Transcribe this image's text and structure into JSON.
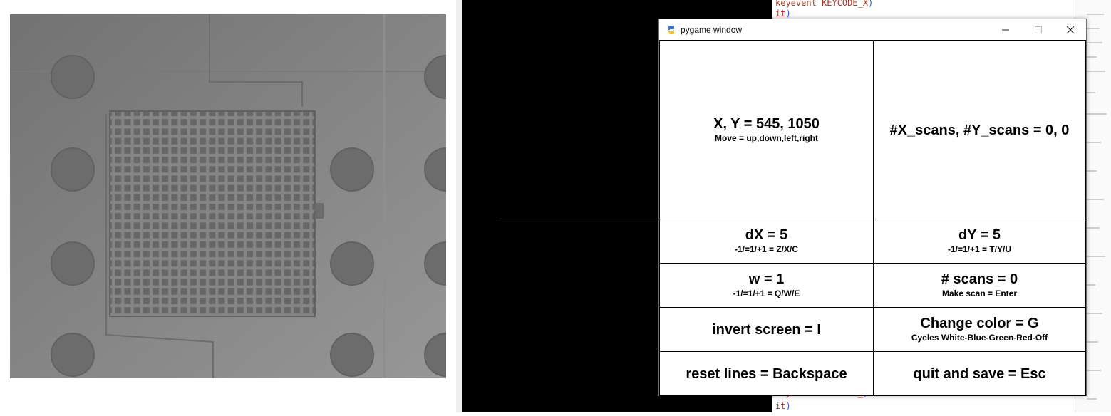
{
  "editor": {
    "line_top": "keyevent KEYCODE_X",
    "line_top2_prefix": "it",
    "line_bottom": "keyevent KEYCODE_",
    "line_bottom2_prefix": "it"
  },
  "window": {
    "title": "pygame window",
    "icon": "pygame-snake-icon"
  },
  "cells": {
    "position": {
      "title": "X, Y = 545, 1050",
      "hint": "Move = up,down,left,right"
    },
    "scans_xy": {
      "title": "#X_scans, #Y_scans = 0, 0"
    },
    "dx": {
      "title": "dX = 5",
      "hint": "-1/=1/+1 = Z/X/C"
    },
    "dy": {
      "title": "dY = 5",
      "hint": "-1/=1/+1 = T/Y/U"
    },
    "w": {
      "title": "w = 1",
      "hint": "-1/=1/+1 = Q/W/E"
    },
    "scans": {
      "title": "# scans = 0",
      "hint": "Make scan = Enter"
    },
    "invert": {
      "title": "invert screen = I"
    },
    "color": {
      "title": "Change color = G",
      "hint": "Cycles White-Blue-Green-Red-Off"
    },
    "reset": {
      "title": "reset lines = Backspace"
    },
    "quit": {
      "title": "quit and save = Esc"
    }
  },
  "colors": {
    "line_blue": "#1a2bd6",
    "desktop": "#000000"
  }
}
